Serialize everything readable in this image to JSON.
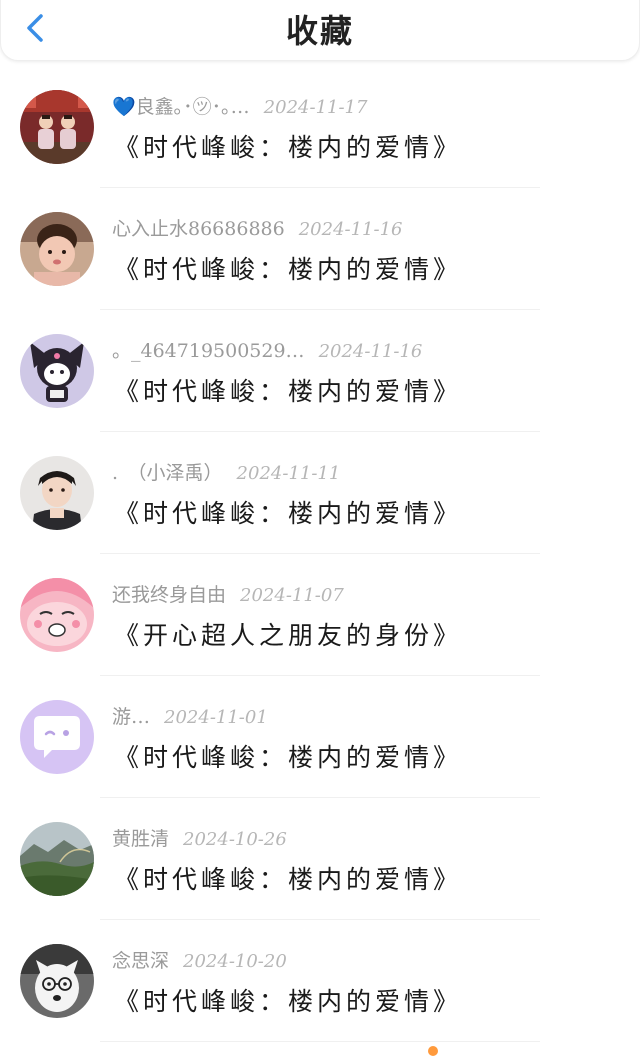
{
  "header": {
    "title": "收藏",
    "back_icon": "chevron-left-icon",
    "accent_color": "#3a8ee6"
  },
  "items": [
    {
      "user": "💙良鑫｡･㋡･｡…",
      "date": "2024-11-17",
      "title": "《时代峰峻：楼内的爱情》",
      "avatar": "photo-two-kids-avatar"
    },
    {
      "user": "心入止水86686886",
      "date": "2024-11-16",
      "title": "《时代峰峻：楼内的爱情》",
      "avatar": "photo-baby-avatar"
    },
    {
      "user": "。_464719500529…",
      "date": "2024-11-16",
      "title": "《时代峰峻：楼内的爱情》",
      "avatar": "kuromi-avatar"
    },
    {
      "user": ".　（小泽禹）",
      "date": "2024-11-11",
      "title": "《时代峰峻：楼内的爱情》",
      "avatar": "photo-boy-avatar"
    },
    {
      "user": "还我终身自由",
      "date": "2024-11-07",
      "title": "《开心超人之朋友的身份》",
      "avatar": "pink-cartoon-avatar"
    },
    {
      "user": "游…",
      "date": "2024-11-01",
      "title": "《时代峰峻：楼内的爱情》",
      "avatar": "chat-bubble-avatar"
    },
    {
      "user": "黄胜清",
      "date": "2024-10-26",
      "title": "《时代峰峻：楼内的爱情》",
      "avatar": "landscape-avatar"
    },
    {
      "user": "念思深",
      "date": "2024-10-20",
      "title": "《时代峰峻：楼内的爱情》",
      "avatar": "dog-with-glasses-avatar"
    }
  ]
}
